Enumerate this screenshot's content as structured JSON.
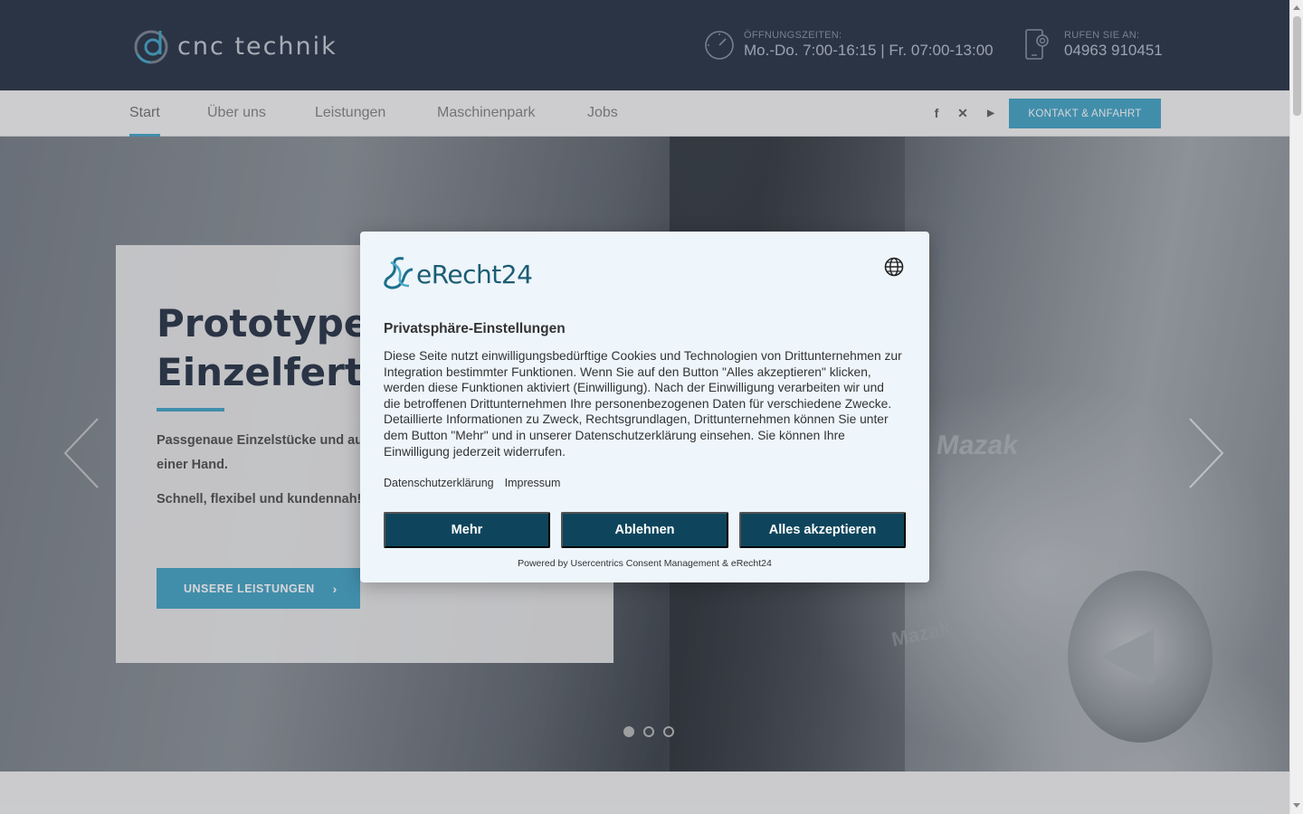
{
  "header": {
    "logo_text": "cnc technik",
    "hours_label": "ÖFFNUNGSZEITEN:",
    "hours_value": "Mo.-Do. 7:00-16:15 | Fr. 07:00-13:00",
    "phone_label": "RUFEN SIE AN:",
    "phone_value": "04963 910451"
  },
  "nav": {
    "items": [
      {
        "label": "Start",
        "active": true
      },
      {
        "label": "Über uns"
      },
      {
        "label": "Leistungen"
      },
      {
        "label": "Maschinenpark"
      },
      {
        "label": "Jobs"
      }
    ],
    "social": [
      {
        "icon": "facebook-icon",
        "glyph": "f"
      },
      {
        "icon": "xing-icon",
        "glyph": "✕"
      },
      {
        "icon": "youtube-icon",
        "glyph": "▶"
      }
    ],
    "cta_label": "KONTAKT & ANFAHRT"
  },
  "hero": {
    "title_line1": "Prototypen",
    "title_line2": "Einzelfertig",
    "text1": "Passgenaue Einzelstücke und aus einer Hand.",
    "text1_a": "Passgenaue Einzelstücke und aus",
    "text1_b": "einer Hand.",
    "text2": "Schnell, flexibel und kundennah!",
    "button_label": "UNSERE LEISTUNGEN",
    "button_chevron": "›",
    "machine_brand": "Mazak",
    "slides_total": 3,
    "slide_active": 1
  },
  "consent": {
    "brand": "eRecht24",
    "title": "Privatsphäre-Einstellungen",
    "body": "Diese Seite nutzt einwilligungsbedürftige Cookies und Technologien von Drittunternehmen zur Integration bestimmter Funktionen. Wenn Sie auf den Button \"Alles akzeptieren\" klicken, werden diese Funktionen aktiviert (Einwilligung). Nach der Einwilligung verarbeiten wir und die betroffenen Drittunternehmen Ihre personenbezogenen Daten für verschiedene Zwecke. Detaillierte Informationen zu Zweck, Rechtsgrundlagen, Drittunternehmen können Sie unter dem Button \"Mehr\" und in unserer Datenschutzerklärung einsehen. Sie können Ihre Einwilligung jederzeit widerrufen.",
    "link_privacy": "Datenschutzerklärung",
    "link_imprint": "Impressum",
    "btn_more": "Mehr",
    "btn_decline": "Ablehnen",
    "btn_accept": "Alles akzeptieren",
    "powered": "Powered by Usercentrics Consent Management & eRecht24"
  },
  "colors": {
    "header_bg": "#2e3a4c",
    "accent": "#4aa8c8",
    "modal_button": "#0e455c"
  }
}
